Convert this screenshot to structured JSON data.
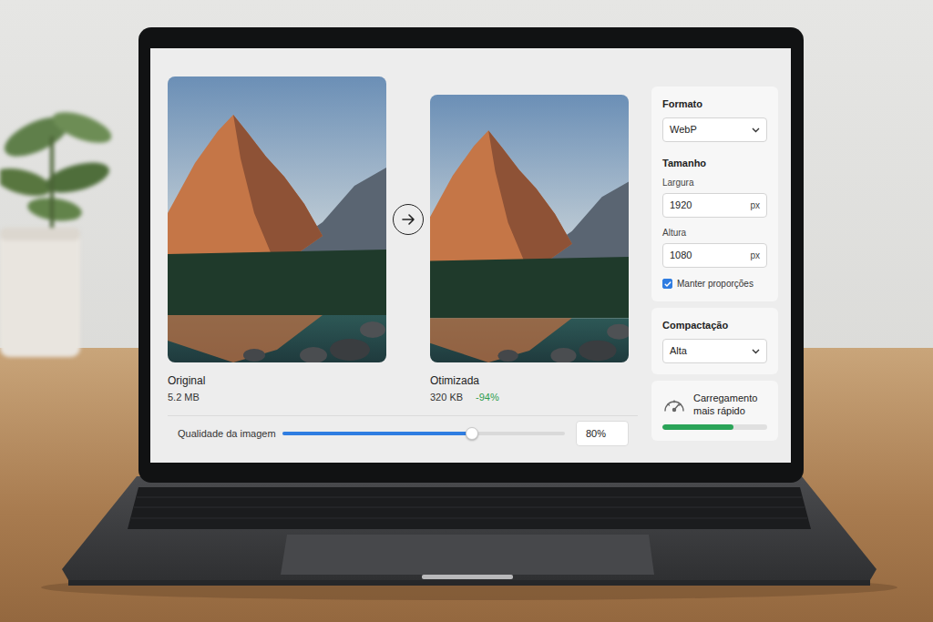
{
  "original": {
    "label": "Original",
    "size": "5.2 MB"
  },
  "optimized": {
    "label": "Otimizada",
    "size": "320 KB",
    "reduction": "-94%"
  },
  "quality": {
    "label": "Qualidade da imagem",
    "level": 0.67,
    "value": "80%"
  },
  "settings": {
    "format": {
      "label": "Formato",
      "value": "WebP"
    },
    "size": {
      "label": "Tamanho",
      "width": {
        "label": "Largura",
        "value": "1920",
        "unit": "px"
      },
      "height": {
        "label": "Altura",
        "value": "1080",
        "unit": "px"
      }
    },
    "keep_ratio": {
      "label": "Manter proporções",
      "checked": true
    }
  },
  "compression": {
    "label": "Compactação",
    "value": "Alta"
  },
  "speed": {
    "label": "Carregamento mais rápido",
    "level": 0.68
  }
}
